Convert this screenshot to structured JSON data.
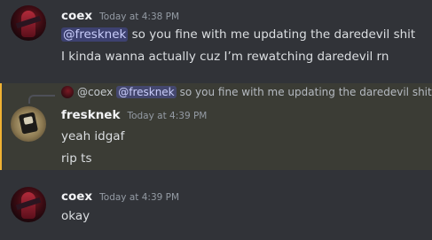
{
  "messages": [
    {
      "username": "coex",
      "timestamp": "Today at 4:38 PM",
      "lines": [
        {
          "mention": "@fresknek",
          "text": " so you fine with me updating the daredevil shit"
        },
        {
          "text": "I kinda wanna actually cuz I’m rewatching daredevil rn"
        }
      ]
    },
    {
      "reply": {
        "username": "@coex",
        "mention": "@fresknek",
        "text": "so you fine with me updating the daredevil shit"
      },
      "username": "fresknek",
      "timestamp": "Today at 4:39 PM",
      "lines": [
        {
          "text": "yeah idgaf"
        },
        {
          "text": "rip ts"
        }
      ]
    },
    {
      "username": "coex",
      "timestamp": "Today at 4:39 PM",
      "lines": [
        {
          "text": "okay"
        }
      ]
    }
  ],
  "colors": {
    "background": "#313338",
    "highlight": "#3b3c35",
    "mention_bg": "#5865f2",
    "highlight_bar": "#f0b232"
  }
}
